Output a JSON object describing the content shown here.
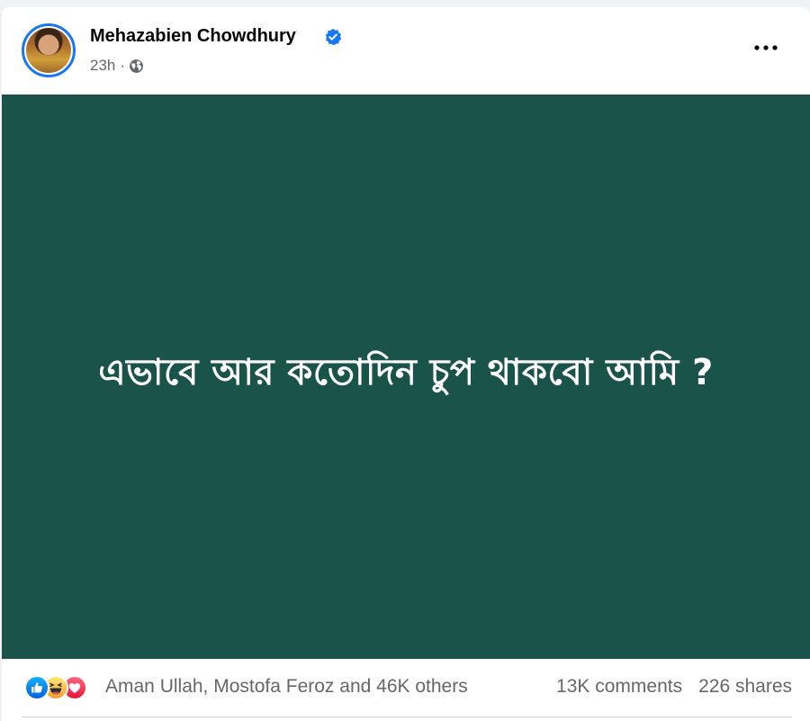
{
  "post": {
    "author": "Mehazabien Chowdhury",
    "time": "23h",
    "separator": "·",
    "verified": true,
    "privacy_icon": "globe-icon",
    "more_icon": "more-options-icon",
    "text": "এভাবে আর কতোদিন চুপ থাকবো আমি ?",
    "background_color": "#19534a"
  },
  "engagement": {
    "reaction_icons": [
      "like-icon",
      "haha-icon",
      "love-icon"
    ],
    "likers": "Aman Ullah, Mostofa Feroz and 46K others",
    "comments": "13K comments",
    "shares": "226 shares"
  },
  "colors": {
    "accent": "#1877f2",
    "secondary_text": "#65676b"
  }
}
